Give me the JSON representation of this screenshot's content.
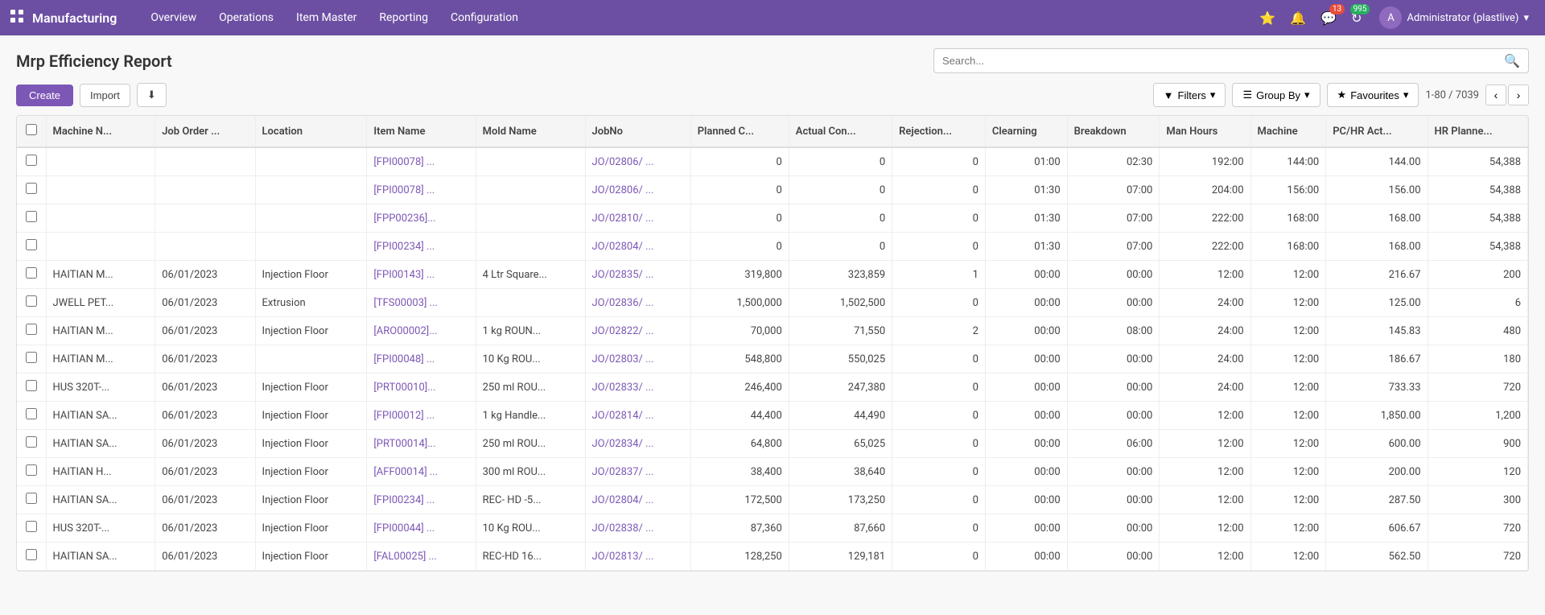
{
  "app": {
    "brand": "Manufacturing",
    "nav_items": [
      "Overview",
      "Operations",
      "Item Master",
      "Reporting",
      "Configuration"
    ]
  },
  "header": {
    "title": "Mrp Efficiency Report",
    "search_placeholder": "Search..."
  },
  "toolbar": {
    "create_label": "Create",
    "import_label": "Import",
    "download_icon": "⬇",
    "filters_label": "Filters",
    "groupby_label": "Group By",
    "favourites_label": "Favourites",
    "pagination": "1-80 / 7039"
  },
  "table": {
    "columns": [
      "Machine N...",
      "Job Order ...",
      "Location",
      "Item Name",
      "Mold Name",
      "JobNo",
      "Planned C...",
      "Actual Con...",
      "Rejection...",
      "Clearning",
      "Breakdown",
      "Man Hours",
      "Machine",
      "PC/HR Act...",
      "HR Planne..."
    ],
    "rows": [
      {
        "machine": "",
        "job_order": "",
        "location": "",
        "item_name": "[FPI00078] ...",
        "mold_name": "",
        "jobno": "JO/02806/ ...",
        "planned": "0",
        "actual": "0",
        "rejection": "0",
        "clearning": "01:00",
        "breakdown": "02:30",
        "man_hours": "192:00",
        "machine_val": "144:00",
        "pc_hr_act": "144.00",
        "hr_planned": "54,388"
      },
      {
        "machine": "",
        "job_order": "",
        "location": "",
        "item_name": "[FPI00078] ...",
        "mold_name": "",
        "jobno": "JO/02806/ ...",
        "planned": "0",
        "actual": "0",
        "rejection": "0",
        "clearning": "01:30",
        "breakdown": "07:00",
        "man_hours": "204:00",
        "machine_val": "156:00",
        "pc_hr_act": "156.00",
        "hr_planned": "54,388"
      },
      {
        "machine": "",
        "job_order": "",
        "location": "",
        "item_name": "[FPP00236]...",
        "mold_name": "",
        "jobno": "JO/02810/ ...",
        "planned": "0",
        "actual": "0",
        "rejection": "0",
        "clearning": "01:30",
        "breakdown": "07:00",
        "man_hours": "222:00",
        "machine_val": "168:00",
        "pc_hr_act": "168.00",
        "hr_planned": "54,388"
      },
      {
        "machine": "",
        "job_order": "",
        "location": "",
        "item_name": "[FPI00234] ...",
        "mold_name": "",
        "jobno": "JO/02804/ ...",
        "planned": "0",
        "actual": "0",
        "rejection": "0",
        "clearning": "01:30",
        "breakdown": "07:00",
        "man_hours": "222:00",
        "machine_val": "168:00",
        "pc_hr_act": "168.00",
        "hr_planned": "54,388"
      },
      {
        "machine": "HAITIAN M...",
        "job_order": "06/01/2023",
        "location": "Injection Floor",
        "item_name": "[FPI00143] ...",
        "mold_name": "4 Ltr Square...",
        "jobno": "JO/02835/ ...",
        "planned": "319,800",
        "actual": "323,859",
        "rejection": "1",
        "clearning": "00:00",
        "breakdown": "00:00",
        "man_hours": "12:00",
        "machine_val": "12:00",
        "pc_hr_act": "216.67",
        "hr_planned": "200"
      },
      {
        "machine": "JWELL PET...",
        "job_order": "06/01/2023",
        "location": "Extrusion",
        "item_name": "[TFS00003] ...",
        "mold_name": "",
        "jobno": "JO/02836/ ...",
        "planned": "1,500,000",
        "actual": "1,502,500",
        "rejection": "0",
        "clearning": "00:00",
        "breakdown": "00:00",
        "man_hours": "24:00",
        "machine_val": "12:00",
        "pc_hr_act": "125.00",
        "hr_planned": "6"
      },
      {
        "machine": "HAITIAN M...",
        "job_order": "06/01/2023",
        "location": "Injection Floor",
        "item_name": "[ARO00002]...",
        "mold_name": "1 kg ROUN...",
        "jobno": "JO/02822/ ...",
        "planned": "70,000",
        "actual": "71,550",
        "rejection": "2",
        "clearning": "00:00",
        "breakdown": "08:00",
        "man_hours": "24:00",
        "machine_val": "12:00",
        "pc_hr_act": "145.83",
        "hr_planned": "480"
      },
      {
        "machine": "HAITIAN M...",
        "job_order": "06/01/2023",
        "location": "",
        "item_name": "[FPI00048] ...",
        "mold_name": "10 Kg ROU...",
        "jobno": "JO/02803/ ...",
        "planned": "548,800",
        "actual": "550,025",
        "rejection": "0",
        "clearning": "00:00",
        "breakdown": "00:00",
        "man_hours": "24:00",
        "machine_val": "12:00",
        "pc_hr_act": "186.67",
        "hr_planned": "180"
      },
      {
        "machine": "HUS 320T-...",
        "job_order": "06/01/2023",
        "location": "Injection Floor",
        "item_name": "[PRT00010]...",
        "mold_name": "250 ml ROU...",
        "jobno": "JO/02833/ ...",
        "planned": "246,400",
        "actual": "247,380",
        "rejection": "0",
        "clearning": "00:00",
        "breakdown": "00:00",
        "man_hours": "24:00",
        "machine_val": "12:00",
        "pc_hr_act": "733.33",
        "hr_planned": "720"
      },
      {
        "machine": "HAITIAN SA...",
        "job_order": "06/01/2023",
        "location": "Injection Floor",
        "item_name": "[FPI00012] ...",
        "mold_name": "1 kg Handle...",
        "jobno": "JO/02814/ ...",
        "planned": "44,400",
        "actual": "44,490",
        "rejection": "0",
        "clearning": "00:00",
        "breakdown": "00:00",
        "man_hours": "12:00",
        "machine_val": "12:00",
        "pc_hr_act": "1,850.00",
        "hr_planned": "1,200"
      },
      {
        "machine": "HAITIAN SA...",
        "job_order": "06/01/2023",
        "location": "Injection Floor",
        "item_name": "[PRT00014]...",
        "mold_name": "250 ml ROU...",
        "jobno": "JO/02834/ ...",
        "planned": "64,800",
        "actual": "65,025",
        "rejection": "0",
        "clearning": "00:00",
        "breakdown": "06:00",
        "man_hours": "12:00",
        "machine_val": "12:00",
        "pc_hr_act": "600.00",
        "hr_planned": "900"
      },
      {
        "machine": "HAITIAN H...",
        "job_order": "06/01/2023",
        "location": "Injection Floor",
        "item_name": "[AFF00014] ...",
        "mold_name": "300 ml ROU...",
        "jobno": "JO/02837/ ...",
        "planned": "38,400",
        "actual": "38,640",
        "rejection": "0",
        "clearning": "00:00",
        "breakdown": "00:00",
        "man_hours": "12:00",
        "machine_val": "12:00",
        "pc_hr_act": "200.00",
        "hr_planned": "120"
      },
      {
        "machine": "HAITIAN SA...",
        "job_order": "06/01/2023",
        "location": "Injection Floor",
        "item_name": "[FPI00234] ...",
        "mold_name": "REC- HD -5...",
        "jobno": "JO/02804/ ...",
        "planned": "172,500",
        "actual": "173,250",
        "rejection": "0",
        "clearning": "00:00",
        "breakdown": "00:00",
        "man_hours": "12:00",
        "machine_val": "12:00",
        "pc_hr_act": "287.50",
        "hr_planned": "300"
      },
      {
        "machine": "HUS 320T-...",
        "job_order": "06/01/2023",
        "location": "Injection Floor",
        "item_name": "[FPI00044] ...",
        "mold_name": "10 Kg ROU...",
        "jobno": "JO/02838/ ...",
        "planned": "87,360",
        "actual": "87,660",
        "rejection": "0",
        "clearning": "00:00",
        "breakdown": "00:00",
        "man_hours": "12:00",
        "machine_val": "12:00",
        "pc_hr_act": "606.67",
        "hr_planned": "720"
      },
      {
        "machine": "HAITIAN SA...",
        "job_order": "06/01/2023",
        "location": "Injection Floor",
        "item_name": "[FAL00025] ...",
        "mold_name": "REC-HD 16...",
        "jobno": "JO/02813/ ...",
        "planned": "128,250",
        "actual": "129,181",
        "rejection": "0",
        "clearning": "00:00",
        "breakdown": "00:00",
        "man_hours": "12:00",
        "machine_val": "12:00",
        "pc_hr_act": "562.50",
        "hr_planned": "720"
      }
    ]
  },
  "icons": {
    "grid": "⊞",
    "search": "🔍",
    "bell": "🔔",
    "chat": "💬",
    "refresh": "↻",
    "star": "★",
    "filter": "▼",
    "chevron_down": "▾",
    "prev_page": "‹",
    "next_page": "›"
  },
  "badges": {
    "chat_count": "13",
    "refresh_count": "995"
  }
}
